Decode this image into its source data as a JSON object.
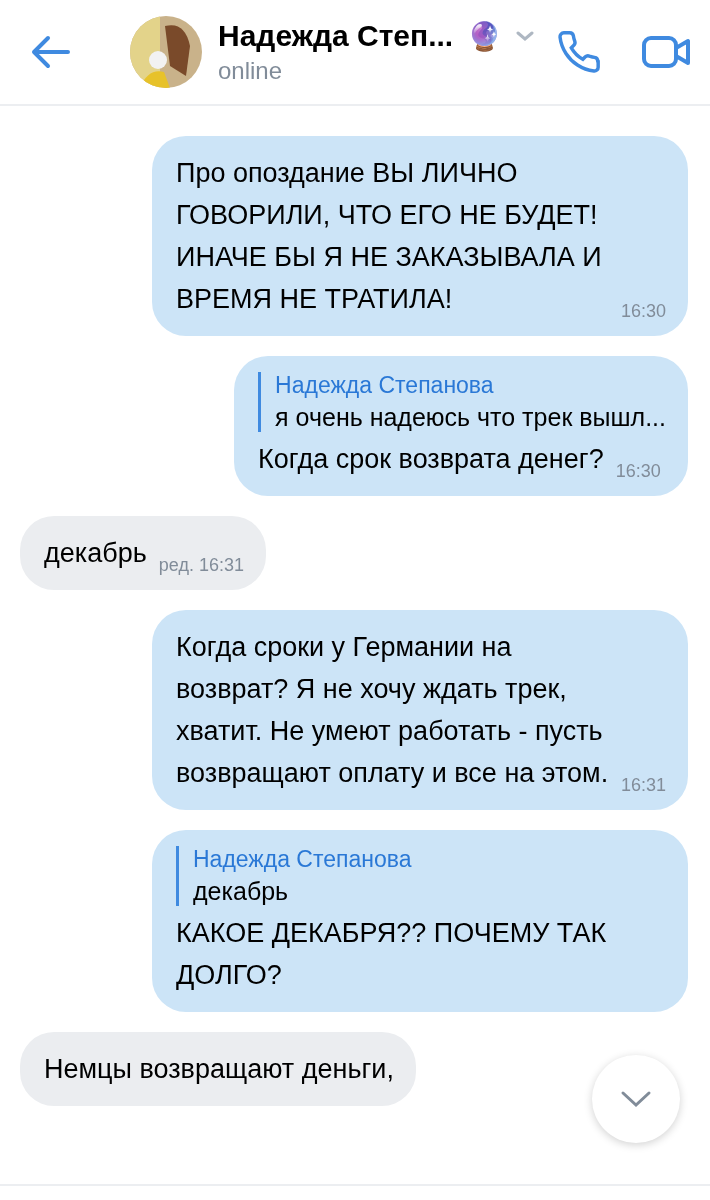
{
  "header": {
    "name": "Надежда Степ...",
    "emoji": "🔮",
    "status": "online"
  },
  "messages": [
    {
      "kind": "outgoing",
      "text": "Про опоздание ВЫ ЛИЧНО ГОВОРИЛИ, ЧТО ЕГО НЕ БУДЕТ! ИНАЧЕ БЫ Я НЕ ЗАКАЗЫВАЛА И ВРЕМЯ НЕ ТРАТИЛА!",
      "time": "16:30"
    },
    {
      "kind": "outgoing",
      "reply": {
        "author": "Надежда Степанова",
        "text": "я очень надеюсь что трек вышл..."
      },
      "text": "Когда срок возврата денег?",
      "time": "16:30"
    },
    {
      "kind": "incoming",
      "text": "декабрь",
      "time": "ред. 16:31"
    },
    {
      "kind": "outgoing",
      "text": "Когда сроки у Германии на возврат? Я не хочу ждать трек, хватит. Не умеют работать - пусть возвращают оплату и все на этом.",
      "time": "16:31"
    },
    {
      "kind": "outgoing",
      "reply": {
        "author": "Надежда Степанова",
        "text": "декабрь"
      },
      "text": "КАКОЕ ДЕКАБРЯ?? ПОЧЕМУ ТАК ДОЛГО?"
    },
    {
      "kind": "incoming",
      "text": "Немцы возвращают деньги,"
    }
  ]
}
